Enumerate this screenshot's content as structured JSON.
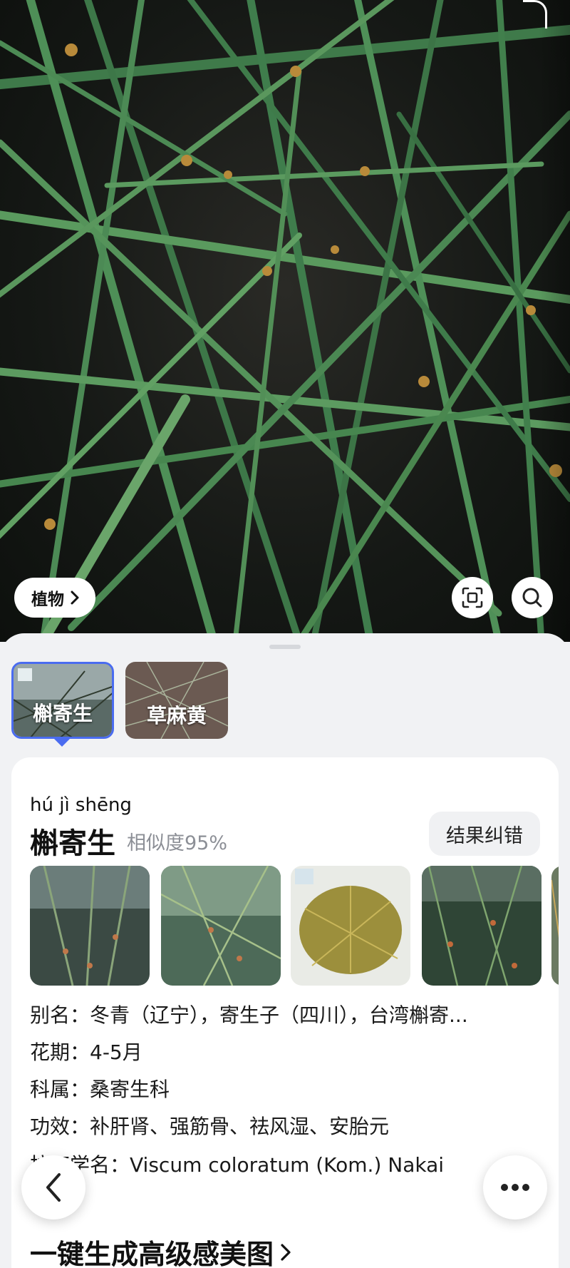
{
  "photo": {
    "alt_icon": "plant-photo"
  },
  "category_chip": {
    "label": "植物",
    "icon": "chevron-right-icon"
  },
  "toolbar": {
    "crop_icon": "scan-frame-icon",
    "search_icon": "search-icon"
  },
  "candidates": [
    {
      "name": "槲寄生",
      "selected": true
    },
    {
      "name": "草麻黄",
      "selected": false
    }
  ],
  "result": {
    "pinyin": "hú jì shēng",
    "name": "槲寄生",
    "similarity": "相似度95%",
    "correct_button": "结果纠错",
    "info": {
      "alias_label": "别名：",
      "alias_value": "冬青（辽宁），寄生子（四川），台湾槲寄...",
      "flowering_label": "花期：",
      "flowering_value": "4-5月",
      "family_label": "科属：",
      "family_value": "桑寄生科",
      "effect_label": "功效：",
      "effect_value": "补肝肾、强筋骨、祛风湿、安胎元",
      "latin_label": "拉丁学名：",
      "latin_value": "Viscum coloratum (Kom.) Nakai"
    },
    "generate_link": "一键生成高级感美图"
  },
  "colors": {
    "accent": "#4a6cf0",
    "sheet_bg": "#f1f2f4"
  }
}
